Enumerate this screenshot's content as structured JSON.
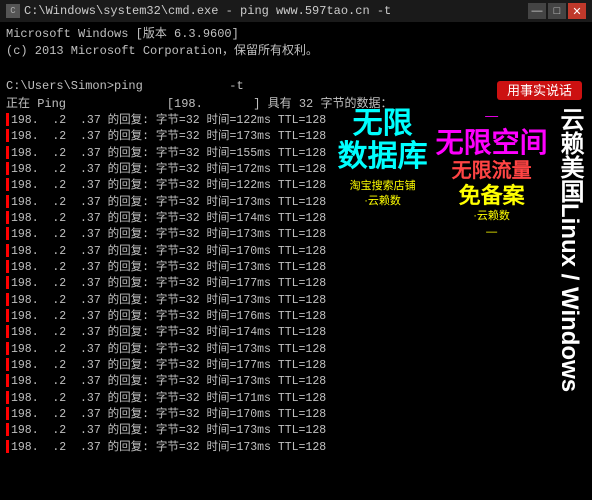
{
  "titlebar": {
    "icon_label": "C",
    "title": "C:\\Windows\\system32\\cmd.exe - ping  www.597tao.cn -t",
    "minimize": "—",
    "maximize": "□",
    "close": "✕"
  },
  "cmd": {
    "line1": "Microsoft Windows [版本 6.3.9600]",
    "line2": "(c) 2013 Microsoft Corporation。保留所有权利。",
    "line3": "",
    "prompt": "C:\\Users\\Simon>ping",
    "ping_cmd": "           -t",
    "ping_info": "正在 Ping              [198.        ] 具有 32 字节的数据：",
    "bubble": "用事实说话",
    "rows": [
      "198.  .2  .37 的回复: 字节=32 时间=122ms TTL=128",
      "198.  .2  .37 的回复: 字节=32 时间=173ms TTL=128",
      "198.  .2  .37 的回复: 字节=32 时间=155ms TTL=128",
      "198.  .2  .37 的回复: 字节=32 时间=172ms TTL=128",
      "198.  .2  .37 的回复: 字节=32 时间=122ms TTL=128",
      "198.  .2  .37 的回复: 字节=32 时间=173ms TTL=128",
      "198.  .2  .37 的回复: 字节=32 时间=174ms TTL=128",
      "198.  .2  .37 的回复: 字节=32 时间=173ms TTL=128",
      "198.  .2  .37 的回复: 字节=32 时间=170ms TTL=128",
      "198.  .2  .37 的回复: 字节=32 时间=173ms TTL=128",
      "198.  .2  .37 的回复: 字节=32 时间=177ms TTL=128",
      "198.  .2  .37 的回复: 字节=32 时间=173ms TTL=128",
      "198.  .2  .37 的回复: 字节=32 时间=176ms TTL=128",
      "198.  .2  .37 的回复: 字节=32 时间=174ms TTL=128",
      "198.  .2  .37 的回复: 字节=32 时间=173ms TTL=128",
      "198.  .2  .37 的回复: 字节=32 时间=177ms TTL=128",
      "198.  .2  .37 的回复: 字节=32 时间=173ms TTL=128",
      "198.  .2  .37 的回复: 字节=32 时间=171ms TTL=128",
      "198.  .2  .37 的回复: 字节=32 时间=170ms TTL=128",
      "198.  .2  .37 的回复: 字节=32 时间=173ms TTL=128",
      "198.  .2  .37 的回复: 字节=32 时间=173ms TTL=128"
    ],
    "overlay_texts": {
      "bubble": "用事实说话",
      "col1_line1": "无限",
      "col1_line2": "数据库",
      "col1_line3": "淘宝搜索店铺",
      "col2_line1": "—",
      "col2_line2": "无限空间",
      "col2_line3": "无限流量",
      "col2_line4": "·云赖数",
      "right_col": "云赖美国Linux / Windows",
      "free_label": "免备案",
      "dash_label": "—"
    }
  },
  "colors": {
    "accent_cyan": "#00ffff",
    "accent_magenta": "#ff00ff",
    "accent_yellow": "#ffff00",
    "accent_red": "#ff0000",
    "accent_green": "#00ff00",
    "terminal_bg": "#000000",
    "terminal_text": "#c0c0c0"
  }
}
